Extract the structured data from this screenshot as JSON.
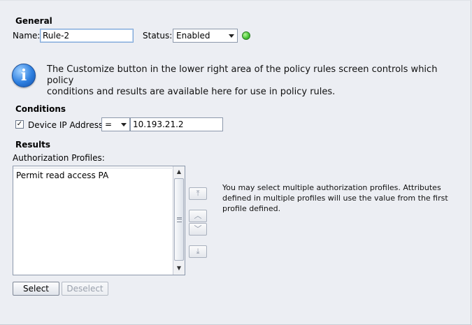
{
  "general": {
    "title": "General",
    "name_label": "Name:",
    "name_value": "Rule-2",
    "status_label": "Status:",
    "status_value": "Enabled",
    "status_color": "#4cc83a"
  },
  "info": {
    "icon": "info-icon",
    "text_line1": "The Customize button in the lower right area of the policy rules screen controls which policy",
    "text_line2": "conditions and results are available here for use in policy rules."
  },
  "conditions": {
    "title": "Conditions",
    "checkbox_checked": true,
    "device_ip_label": "Device IP Address:",
    "operator": "=",
    "ip_value": "10.193.21.2"
  },
  "results": {
    "title": "Results",
    "profiles_label": "Authorization Profiles:",
    "profiles": [
      "Permit read access PA"
    ],
    "help_line1": "You may select multiple authorization profiles. Attributes",
    "help_line2": "defined in multiple profiles will use the value from the first",
    "help_line3": "profile defined.",
    "select_label": "Select",
    "deselect_label": "Deselect"
  }
}
